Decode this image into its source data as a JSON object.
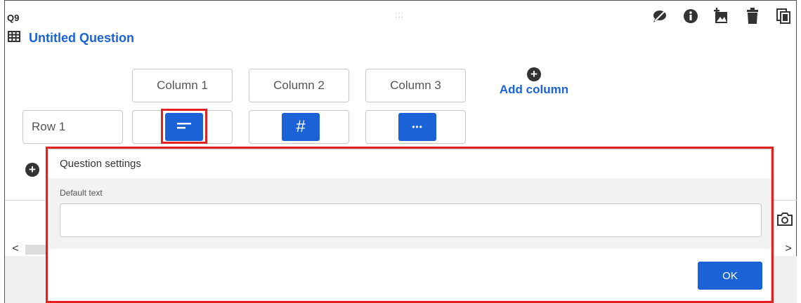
{
  "question": {
    "number": "Q9",
    "title": "Untitled Question",
    "drag_handle": ":::",
    "icons": [
      "table-icon",
      "skip-logic-icon",
      "info-icon",
      "add-image-icon",
      "delete-icon",
      "copy-icon"
    ]
  },
  "matrix": {
    "columns": [
      "Column 1",
      "Column 2",
      "Column 3"
    ],
    "add_column_label": "Add column",
    "rows": [
      "Row 1"
    ],
    "answer_types": [
      {
        "type": "text",
        "icon": "text-lines-icon",
        "glyph": ""
      },
      {
        "type": "number",
        "icon": "hash-icon",
        "glyph": "#"
      },
      {
        "type": "dropdown",
        "icon": "more-dots-icon",
        "glyph": "•••"
      }
    ]
  },
  "dialog": {
    "title": "Question settings",
    "field_label": "Default text",
    "field_value": "",
    "ok_label": "OK"
  },
  "scrollbar": {
    "left_arrow": "<",
    "right_arrow": ">"
  },
  "colors": {
    "accent": "#1b62d6",
    "highlight": "#e32121",
    "panel": "#f2f2f2"
  }
}
